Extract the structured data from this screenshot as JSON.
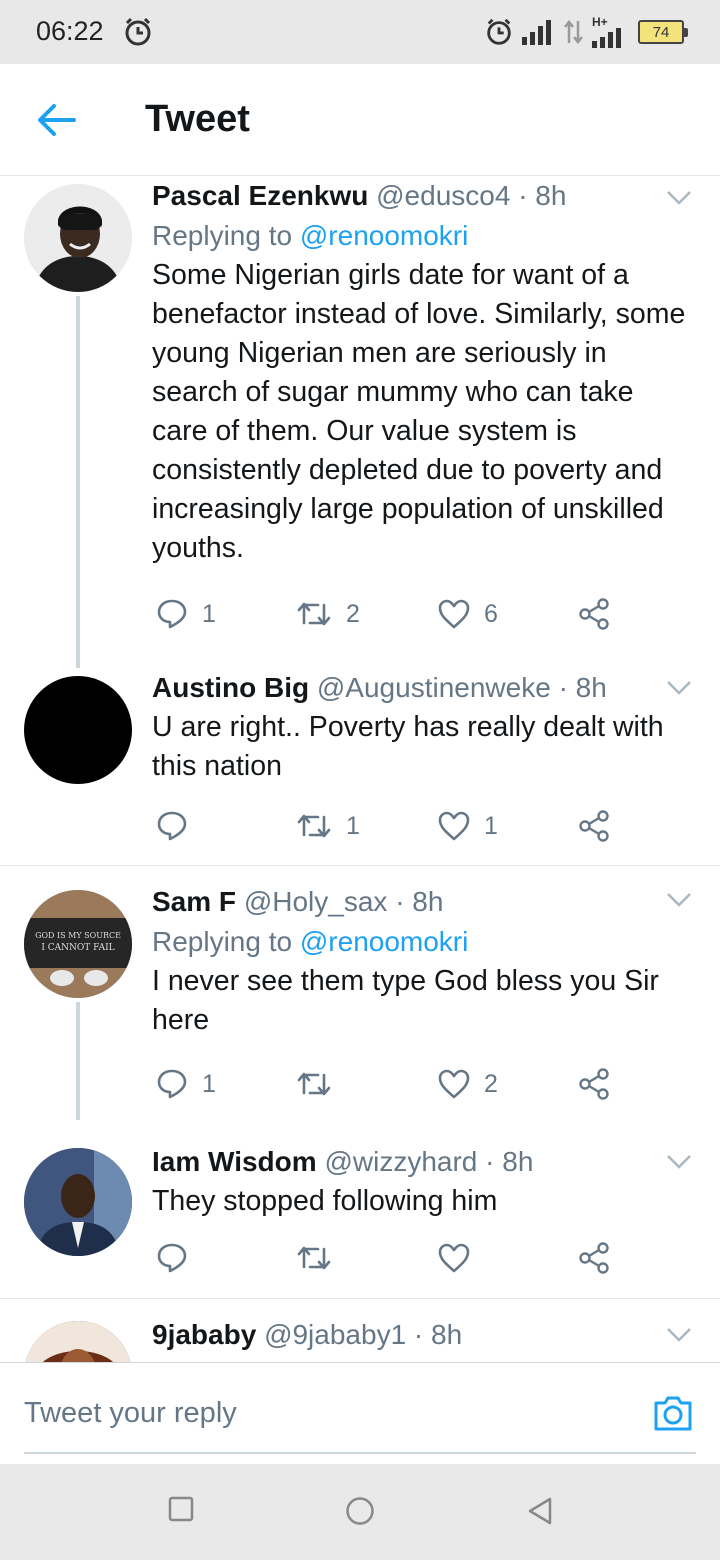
{
  "status_bar": {
    "time": "06:22",
    "network_label": "H+",
    "battery": "74"
  },
  "header": {
    "title": "Tweet"
  },
  "tweets": [
    {
      "name": "Pascal Ezenkwu",
      "handle": "@edusco4",
      "time": "· 8h",
      "replying_prefix": "Replying to ",
      "replying_to": "@renoomokri",
      "text": "Some Nigerian girls date for want of a benefactor instead of love. Similarly, some young Nigerian men are seriously in search of sugar mummy who can take care of them. Our value system is consistently depleted due to poverty and increasingly large population of unskilled youths.",
      "replies": "1",
      "retweets": "2",
      "likes": "6"
    },
    {
      "name": "Austino Big",
      "handle": "@Augustinenweke",
      "time": "· 8h",
      "text": "U are right.. Poverty has really  dealt with this nation",
      "replies": "",
      "retweets": "1",
      "likes": "1"
    },
    {
      "name": "Sam F",
      "handle": "@Holy_sax",
      "time": "· 8h",
      "replying_prefix": "Replying to ",
      "replying_to": "@renoomokri",
      "avatar_text_1": "GOD IS MY SOURCE",
      "avatar_text_2": "I CANNOT FAIL",
      "text": "I never see them type God bless you Sir here",
      "replies": "1",
      "retweets": "",
      "likes": "2"
    },
    {
      "name": "Iam Wisdom",
      "handle": "@wizzyhard",
      "time": "· 8h",
      "text": "They stopped following him",
      "replies": "",
      "retweets": "",
      "likes": ""
    },
    {
      "name": "9jababy",
      "handle": "@9jababy1",
      "time": "· 8h"
    }
  ],
  "composer": {
    "placeholder": "Tweet your reply"
  },
  "icons": {
    "back": "arrow-left-icon",
    "reply": "reply-bubble-icon",
    "retweet": "retweet-icon",
    "like": "heart-icon",
    "share": "share-icon",
    "camera": "camera-icon",
    "caret": "chevron-down-icon"
  },
  "colors": {
    "accent": "#1da1f2",
    "secondary_text": "#657786",
    "primary_text": "#14171a",
    "divider": "#e1e8ed"
  }
}
